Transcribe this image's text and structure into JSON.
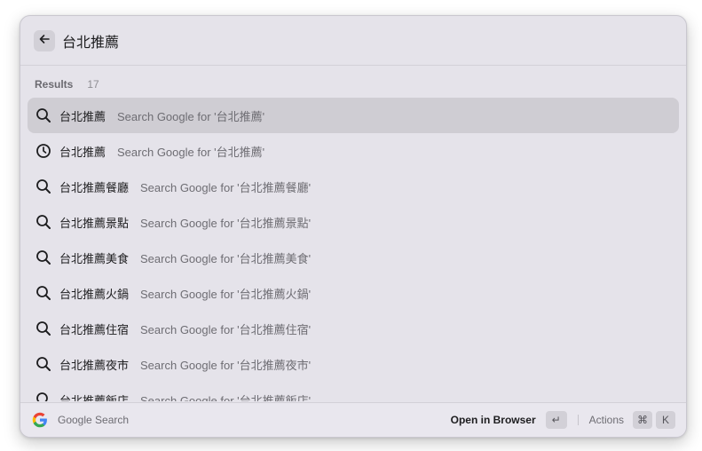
{
  "search": {
    "query": "台北推薦"
  },
  "section": {
    "title": "Results",
    "count": "17"
  },
  "results": [
    {
      "icon": "search-icon",
      "title": "台北推薦",
      "subtitle": "Search Google for '台北推薦'",
      "selected": true
    },
    {
      "icon": "clock-icon",
      "title": "台北推薦",
      "subtitle": "Search Google for '台北推薦'",
      "selected": false
    },
    {
      "icon": "search-icon",
      "title": "台北推薦餐廳",
      "subtitle": "Search Google for '台北推薦餐廳'",
      "selected": false
    },
    {
      "icon": "search-icon",
      "title": "台北推薦景點",
      "subtitle": "Search Google for '台北推薦景點'",
      "selected": false
    },
    {
      "icon": "search-icon",
      "title": "台北推薦美食",
      "subtitle": "Search Google for '台北推薦美食'",
      "selected": false
    },
    {
      "icon": "search-icon",
      "title": "台北推薦火鍋",
      "subtitle": "Search Google for '台北推薦火鍋'",
      "selected": false
    },
    {
      "icon": "search-icon",
      "title": "台北推薦住宿",
      "subtitle": "Search Google for '台北推薦住宿'",
      "selected": false
    },
    {
      "icon": "search-icon",
      "title": "台北推薦夜市",
      "subtitle": "Search Google for '台北推薦夜市'",
      "selected": false
    },
    {
      "icon": "search-icon",
      "title": "台北推薦飯店",
      "subtitle": "Search Google for '台北推薦飯店'",
      "selected": false
    }
  ],
  "footer": {
    "extension_name": "Google Search",
    "primary_action": "Open in Browser",
    "enter_key": "↵",
    "actions_label": "Actions",
    "cmd_key": "⌘",
    "k_key": "K"
  },
  "colors": {
    "window_bg": "#e5e3ea",
    "selected_row": "#cfcdd3",
    "google_blue": "#4285F4",
    "google_red": "#EA4335",
    "google_yellow": "#FBBC05",
    "google_green": "#34A853"
  }
}
